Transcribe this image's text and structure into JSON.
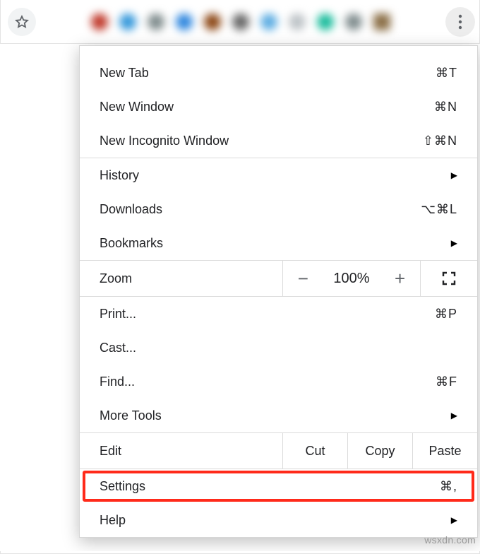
{
  "menu": {
    "newTab": {
      "label": "New Tab",
      "shortcut": "⌘T"
    },
    "newWindow": {
      "label": "New Window",
      "shortcut": "⌘N"
    },
    "incognito": {
      "label": "New Incognito Window",
      "shortcut": "⇧⌘N"
    },
    "history": {
      "label": "History"
    },
    "downloads": {
      "label": "Downloads",
      "shortcut": "⌥⌘L"
    },
    "bookmarks": {
      "label": "Bookmarks"
    },
    "zoom": {
      "label": "Zoom",
      "level": "100%"
    },
    "print": {
      "label": "Print...",
      "shortcut": "⌘P"
    },
    "cast": {
      "label": "Cast..."
    },
    "find": {
      "label": "Find...",
      "shortcut": "⌘F"
    },
    "moreTools": {
      "label": "More Tools"
    },
    "edit": {
      "label": "Edit",
      "cut": "Cut",
      "copy": "Copy",
      "paste": "Paste"
    },
    "settings": {
      "label": "Settings",
      "shortcut": "⌘,"
    },
    "help": {
      "label": "Help"
    }
  },
  "watermark": "wsxdn.com"
}
